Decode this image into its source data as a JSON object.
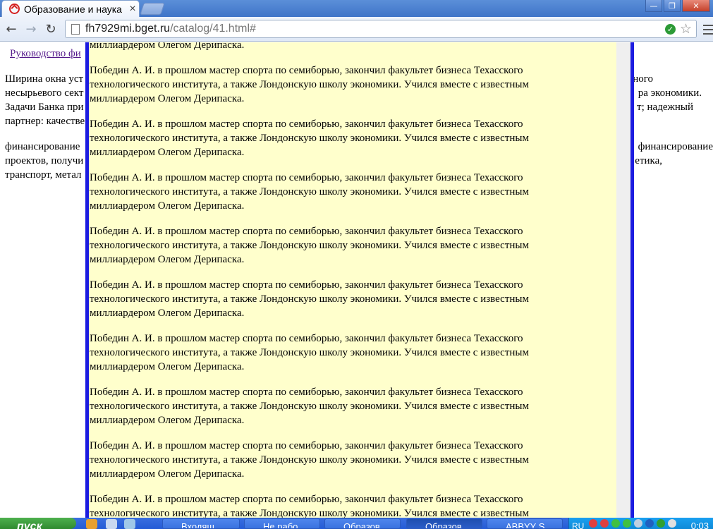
{
  "browser": {
    "tab_title": "Образование и наука",
    "tab_close": "×",
    "url_host": "fh7929mi.bget.ru",
    "url_path": "/catalog/41.html#",
    "back": "←",
    "forward": "→",
    "reload": "↻"
  },
  "page": {
    "link_text": "Руководство фи",
    "background_lines": [
      {
        "left": "Ширина окна уст",
        "right": "ного"
      },
      {
        "left": "несырьевого сект",
        "right": "ра экономики."
      },
      {
        "left": "Задачи Банка при",
        "right": "т; надежный"
      },
      {
        "left": "партнер: качестве",
        "right": ""
      },
      {
        "left": "финансирование",
        "right": "финансирование"
      },
      {
        "left": "проектов, получи",
        "right": "етика,"
      },
      {
        "left": "транспорт, метал",
        "right": ""
      }
    ],
    "overlay_first_fragment": "миллиардером Олегом Дерипаска.",
    "overlay_paragraph": "Победин А. И. в прошлом мастер спорта по семиборью, закончил факультет бизнеса Техасского технологического института, а также Лондонскую школу экономики. Учился вместе с известным миллиардером Олегом Дерипаска.",
    "overlay_paragraph_count": 9
  },
  "taskbar": {
    "start_label": "пуск",
    "items": [
      {
        "label": "Входящ"
      },
      {
        "label": "Не рабо"
      },
      {
        "label": "Образов"
      },
      {
        "label": "Образов"
      },
      {
        "label": "ABBYY S"
      }
    ],
    "lang": "RU",
    "clock": "0:03"
  }
}
